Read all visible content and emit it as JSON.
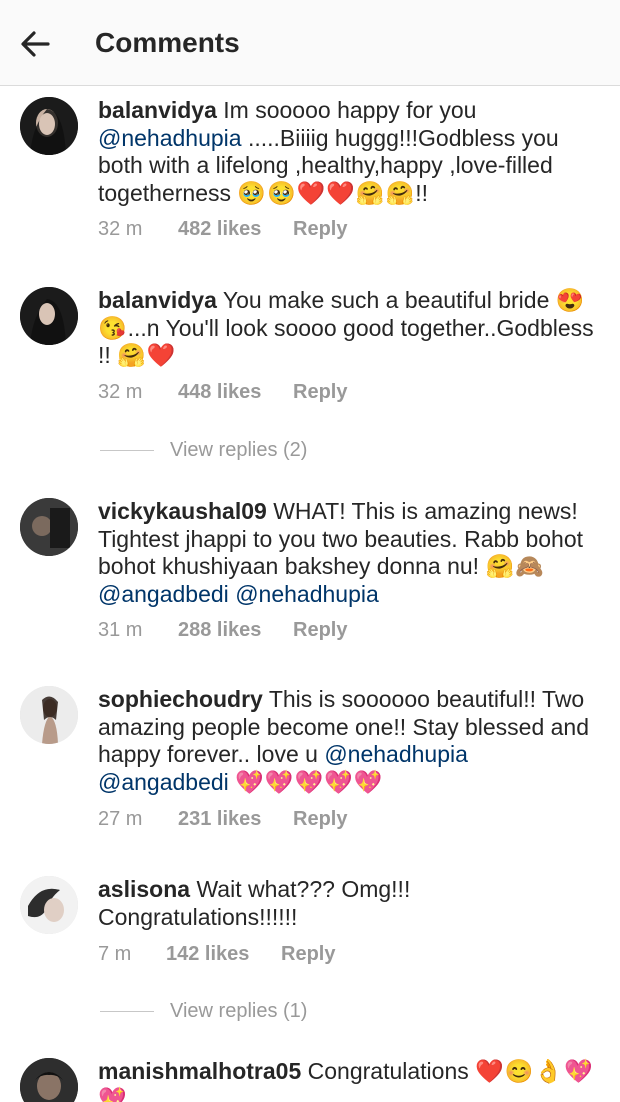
{
  "header": {
    "title": "Comments"
  },
  "comments": [
    {
      "username": "balanvidya",
      "text_1": "Im sooooo happy for you ",
      "mention_1": "@nehadhupia",
      "text_2": " .....Biiiig huggg!!!Godbless you both with a lifelong ,healthy,happy ,love-filled togetherness ",
      "emoji": "🥹🥹❤️❤️🤗🤗",
      "text_3": "!!",
      "time": "32 m",
      "likes": "482 likes",
      "reply": "Reply"
    },
    {
      "username": "balanvidya",
      "text_1": "You make such a beautiful bride ",
      "emoji": "😍😘",
      "text_2": "...n You'll look soooo good together..Godbless !! ",
      "emoji_2": "🤗❤️",
      "time": "32 m",
      "likes": "448 likes",
      "reply": "Reply"
    },
    {
      "username": "vickykaushal09",
      "text_1": "WHAT! This is amazing news! Tightest jhappi to you two beauties. Rabb bohot bohot khushiyaan bakshey donna nu! ",
      "emoji": "🤗🙈",
      "mention_1": "@angadbedi",
      "mention_2": "@nehadhupia",
      "time": "31 m",
      "likes": "288 likes",
      "reply": "Reply"
    },
    {
      "username": "sophiechoudry",
      "text_1": "This is soooooo beautiful!! Two amazing people become one!! Stay blessed and happy forever.. love u ",
      "mention_1": "@nehadhupia",
      "mention_2": "@angadbedi",
      "emoji": "💖💖💖💖💖",
      "time": "27 m",
      "likes": "231 likes",
      "reply": "Reply"
    },
    {
      "username": "aslisona",
      "text_1": "Wait what??? Omg!!! Congratulations!!!!!!",
      "time": "7 m",
      "likes": "142 likes",
      "reply": "Reply"
    },
    {
      "username": "manishmalhotra05",
      "text_1": "Congratulations ",
      "emoji": "❤️😊👌💖💖"
    }
  ],
  "view_replies": [
    "View replies (2)",
    "View replies (1)"
  ]
}
